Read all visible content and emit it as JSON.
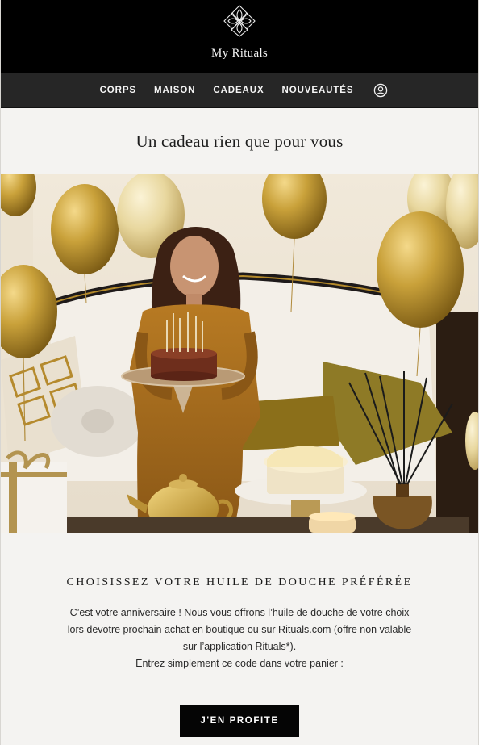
{
  "header": {
    "brand_name": "My Rituals",
    "logo_icon": "lotus-emblem-icon",
    "background": "#000000"
  },
  "nav": {
    "items": [
      {
        "label": "CORPS"
      },
      {
        "label": "MAISON"
      },
      {
        "label": "CADEAUX"
      },
      {
        "label": "NOUVEAUTÉS"
      }
    ],
    "account_icon": "user-account-icon",
    "background": "#262626"
  },
  "headline": "Un cadeau rien que pour vous",
  "hero": {
    "image_subject": "birthday-celebration-photo"
  },
  "offer": {
    "title": "CHOISISSEZ VOTRE HUILE DE DOUCHE PRÉFÉRÉE",
    "line1": "C’est votre anniversaire ! Nous vous offrons l’huile de douche de votre choix",
    "line2": "lors devotre prochain achat en boutique ou sur Rituals.com (offre non valable",
    "line3": "sur l’application Rituals*).",
    "line4": "Entrez simplement ce code dans votre panier :",
    "cta_label": "J'EN PROFITE"
  },
  "colors": {
    "page_bg": "#f4f3f1",
    "cta_bg": "#050505",
    "gold": "#c9a13a"
  }
}
